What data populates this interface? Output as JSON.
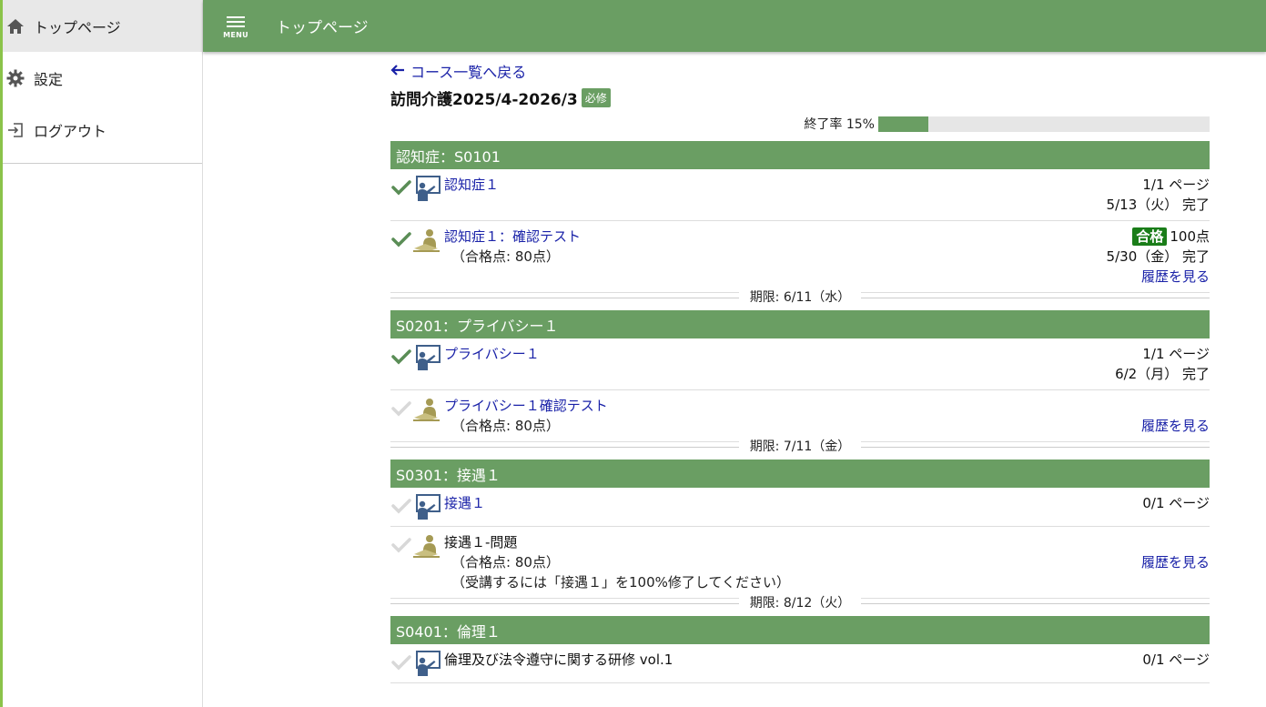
{
  "sidebar": {
    "items": [
      {
        "label": "トップページ",
        "icon": "home-icon"
      },
      {
        "label": "設定",
        "icon": "gear-icon"
      },
      {
        "label": "ログアウト",
        "icon": "logout-icon"
      }
    ]
  },
  "header": {
    "menu_label": "MENU",
    "title": "トップページ"
  },
  "main": {
    "back_link": "コース一覧へ戻る",
    "course_title": "訪問介護2025/4-2026/3",
    "required_badge": "必修",
    "progress_label": "終了率 15%",
    "progress_value": 0.15,
    "sections": [
      {
        "header": "認知症：S0101",
        "lessons": [
          {
            "done": true,
            "type": "lecture",
            "title": "認知症１",
            "link": true,
            "right": [
              "1/1 ページ",
              "5/13（火） 完了"
            ]
          },
          {
            "done": true,
            "type": "test",
            "title": "認知症１：確認テスト",
            "link": true,
            "sub": [
              "（合格点: 80点）"
            ],
            "pass": "合格",
            "score": "100点",
            "right": [
              "5/30（金） 完了"
            ],
            "history": "履歴を見る"
          }
        ],
        "deadline": "期限: 6/11（水）"
      },
      {
        "header": "S0201：プライバシー１",
        "lessons": [
          {
            "done": true,
            "type": "lecture",
            "title": "プライバシー１",
            "link": true,
            "right": [
              "1/1 ページ",
              "6/2（月） 完了"
            ]
          },
          {
            "done": false,
            "type": "test",
            "title": "プライバシー１確認テスト",
            "link": true,
            "sub": [
              "（合格点: 80点）"
            ],
            "history": "履歴を見る"
          }
        ],
        "deadline": "期限: 7/11（金）"
      },
      {
        "header": "S0301：接遇１",
        "lessons": [
          {
            "done": false,
            "type": "lecture",
            "title": "接遇１",
            "link": true,
            "right": [
              "0/1 ページ"
            ]
          },
          {
            "done": false,
            "type": "test",
            "title": "接遇１-問題",
            "link": false,
            "sub": [
              "（合格点: 80点）",
              "（受講するには「接遇１」を100%修了してください）"
            ],
            "history": "履歴を見る"
          }
        ],
        "deadline": "期限: 8/12（火）"
      },
      {
        "header": "S0401：倫理１",
        "lessons": [
          {
            "done": false,
            "type": "lecture",
            "title": "倫理及び法令遵守に関する研修 vol.1",
            "link": false,
            "right": [
              "0/1 ページ"
            ]
          }
        ]
      }
    ]
  },
  "colors": {
    "header_green": "#6a9e63",
    "pass_green": "#1a7d19",
    "link_blue": "#1a22a8",
    "sidebar_accent": "#8bc34a"
  }
}
